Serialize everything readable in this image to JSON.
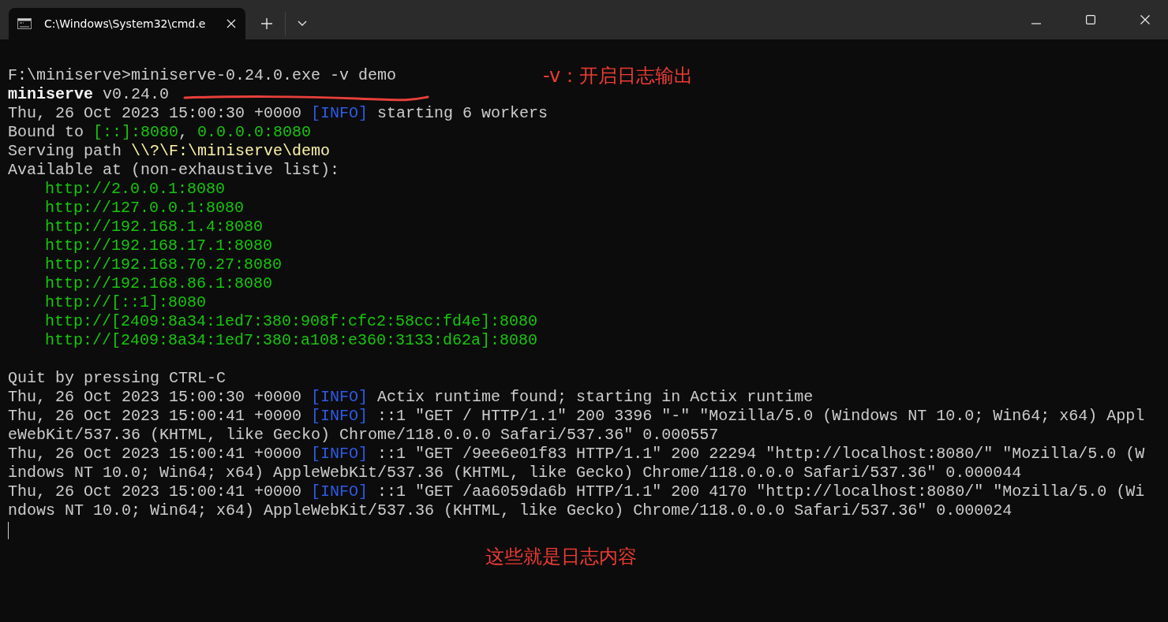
{
  "tab": {
    "title": "C:\\Windows\\System32\\cmd.e",
    "selected": true
  },
  "terminal": {
    "lines": [
      {
        "segments": [
          {
            "kind": "plain",
            "text": "F:\\miniserve>miniserve-0.24.0.exe -v demo"
          }
        ]
      },
      {
        "segments": [
          {
            "kind": "bold",
            "text": "miniserve"
          },
          {
            "kind": "plain",
            "text": " v0.24.0"
          }
        ]
      },
      {
        "segments": [
          {
            "kind": "plain",
            "text": "Thu, 26 Oct 2023 15:00:30 +0000 "
          },
          {
            "kind": "info",
            "text": "[INFO]"
          },
          {
            "kind": "plain",
            "text": " starting 6 workers"
          }
        ]
      },
      {
        "segments": [
          {
            "kind": "plain",
            "text": "Bound to "
          },
          {
            "kind": "green",
            "text": "[::]:8080"
          },
          {
            "kind": "plain",
            "text": ", "
          },
          {
            "kind": "green",
            "text": "0.0.0.0:8080"
          }
        ]
      },
      {
        "segments": [
          {
            "kind": "plain",
            "text": "Serving path "
          },
          {
            "kind": "yellow",
            "text": "\\\\?\\F:\\miniserve\\demo"
          }
        ]
      },
      {
        "segments": [
          {
            "kind": "plain",
            "text": "Available at (non-exhaustive list):"
          }
        ]
      },
      {
        "indent": true,
        "segments": [
          {
            "kind": "green",
            "text": "http://2.0.0.1:8080"
          }
        ]
      },
      {
        "indent": true,
        "segments": [
          {
            "kind": "green",
            "text": "http://127.0.0.1:8080"
          }
        ]
      },
      {
        "indent": true,
        "segments": [
          {
            "kind": "green",
            "text": "http://192.168.1.4:8080"
          }
        ]
      },
      {
        "indent": true,
        "segments": [
          {
            "kind": "green",
            "text": "http://192.168.17.1:8080"
          }
        ]
      },
      {
        "indent": true,
        "segments": [
          {
            "kind": "green",
            "text": "http://192.168.70.27:8080"
          }
        ]
      },
      {
        "indent": true,
        "segments": [
          {
            "kind": "green",
            "text": "http://192.168.86.1:8080"
          }
        ]
      },
      {
        "indent": true,
        "segments": [
          {
            "kind": "green",
            "text": "http://[::1]:8080"
          }
        ]
      },
      {
        "indent": true,
        "segments": [
          {
            "kind": "green",
            "text": "http://[2409:8a34:1ed7:380:908f:cfc2:58cc:fd4e]:8080"
          }
        ]
      },
      {
        "indent": true,
        "segments": [
          {
            "kind": "green",
            "text": "http://[2409:8a34:1ed7:380:a108:e360:3133:d62a]:8080"
          }
        ]
      },
      {
        "gap_before": true,
        "segments": [
          {
            "kind": "plain",
            "text": "Quit by pressing CTRL-C"
          }
        ]
      },
      {
        "segments": [
          {
            "kind": "plain",
            "text": "Thu, 26 Oct 2023 15:00:30 +0000 "
          },
          {
            "kind": "info",
            "text": "[INFO]"
          },
          {
            "kind": "plain",
            "text": " Actix runtime found; starting in Actix runtime"
          }
        ]
      },
      {
        "segments": [
          {
            "kind": "plain",
            "text": "Thu, 26 Oct 2023 15:00:41 +0000 "
          },
          {
            "kind": "info",
            "text": "[INFO]"
          },
          {
            "kind": "plain",
            "text": " ::1 \"GET / HTTP/1.1\" 200 3396 \"-\" \"Mozilla/5.0 (Windows NT 10.0; Win64; x64) Appl"
          }
        ]
      },
      {
        "segments": [
          {
            "kind": "plain",
            "text": "eWebKit/537.36 (KHTML, like Gecko) Chrome/118.0.0.0 Safari/537.36\" 0.000557"
          }
        ]
      },
      {
        "segments": [
          {
            "kind": "plain",
            "text": "Thu, 26 Oct 2023 15:00:41 +0000 "
          },
          {
            "kind": "info",
            "text": "[INFO]"
          },
          {
            "kind": "plain",
            "text": " ::1 \"GET /9ee6e01f83 HTTP/1.1\" 200 22294 \"http://localhost:8080/\" \"Mozilla/5.0 (W"
          }
        ]
      },
      {
        "segments": [
          {
            "kind": "plain",
            "text": "indows NT 10.0; Win64; x64) AppleWebKit/537.36 (KHTML, like Gecko) Chrome/118.0.0.0 Safari/537.36\" 0.000044"
          }
        ]
      },
      {
        "segments": [
          {
            "kind": "plain",
            "text": "Thu, 26 Oct 2023 15:00:41 +0000 "
          },
          {
            "kind": "info",
            "text": "[INFO]"
          },
          {
            "kind": "plain",
            "text": " ::1 \"GET /aa6059da6b HTTP/1.1\" 200 4170 \"http://localhost:8080/\" \"Mozilla/5.0 (Wi"
          }
        ]
      },
      {
        "segments": [
          {
            "kind": "plain",
            "text": "ndows NT 10.0; Win64; x64) AppleWebKit/537.36 (KHTML, like Gecko) Chrome/118.0.0.0 Safari/537.36\" 0.000024"
          }
        ]
      }
    ]
  },
  "annotations": [
    {
      "kind": "top",
      "text": "-v：开启日志输出"
    },
    {
      "kind": "bottom",
      "text": "这些就是日志内容"
    }
  ]
}
